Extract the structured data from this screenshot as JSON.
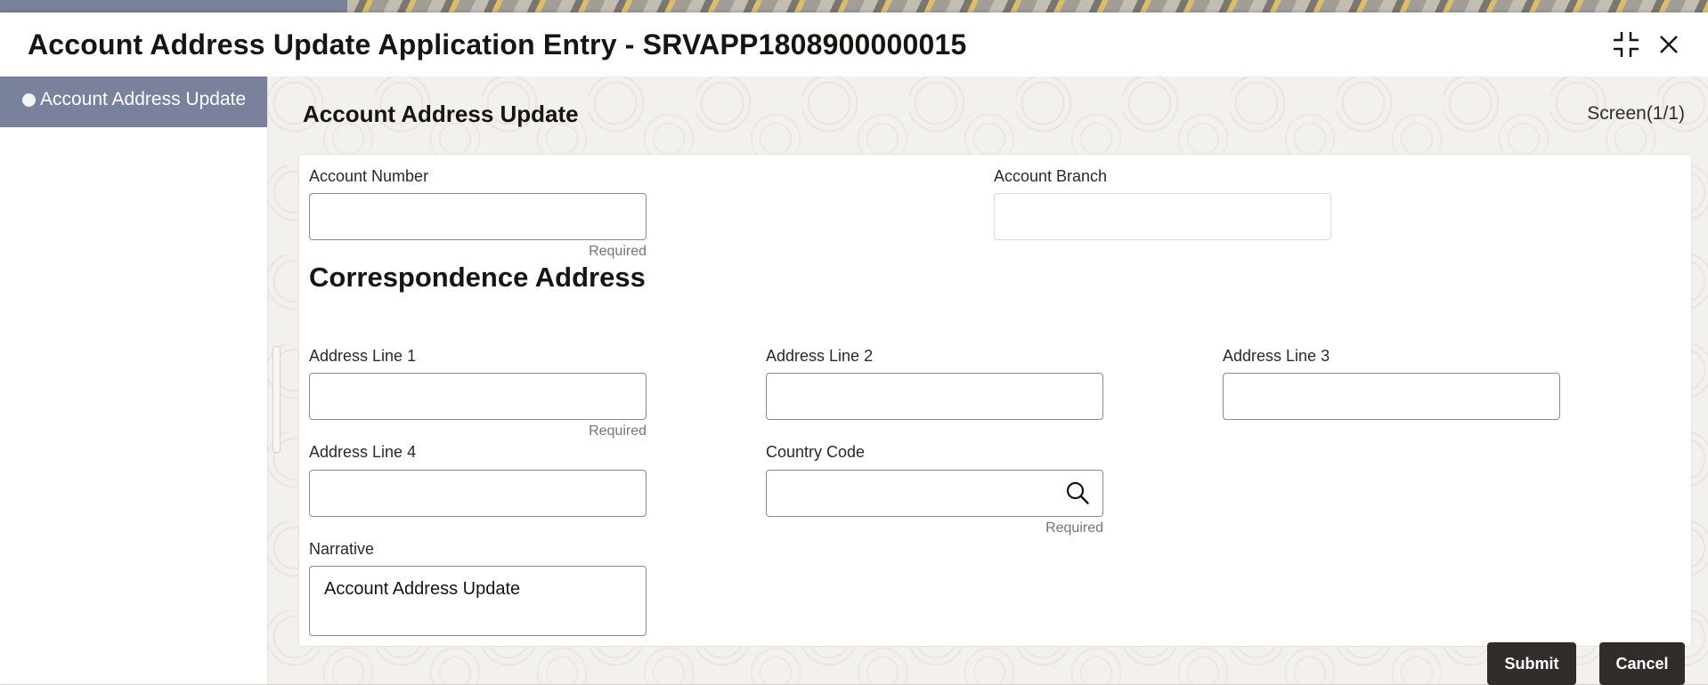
{
  "modal": {
    "title": "Account Address Update Application Entry - SRVAPP1808900000015",
    "minimize_icon": "collapse-icon",
    "close_icon": "close-icon"
  },
  "sidebar": {
    "items": [
      {
        "label": "Account Address Update",
        "active": true
      }
    ]
  },
  "main": {
    "section_title": "Account Address Update",
    "screen_indicator": "Screen(1/1)",
    "account_number": {
      "label": "Account Number",
      "value": "",
      "hint": "Required"
    },
    "account_branch": {
      "label": "Account Branch",
      "value": ""
    },
    "correspondence_title": "Correspondence Address",
    "address_line_1": {
      "label": "Address Line 1",
      "value": "",
      "hint": "Required"
    },
    "address_line_2": {
      "label": "Address Line 2",
      "value": ""
    },
    "address_line_3": {
      "label": "Address Line 3",
      "value": ""
    },
    "address_line_4": {
      "label": "Address Line 4",
      "value": ""
    },
    "country_code": {
      "label": "Country Code",
      "value": "",
      "hint": "Required",
      "icon": "search-icon"
    },
    "narrative": {
      "label": "Narrative",
      "value": "Account Address Update"
    }
  },
  "footer": {
    "submit_label": "Submit",
    "cancel_label": "Cancel"
  },
  "colors": {
    "sidebar_active": "#7a819c",
    "button_dark": "#312d2a"
  }
}
